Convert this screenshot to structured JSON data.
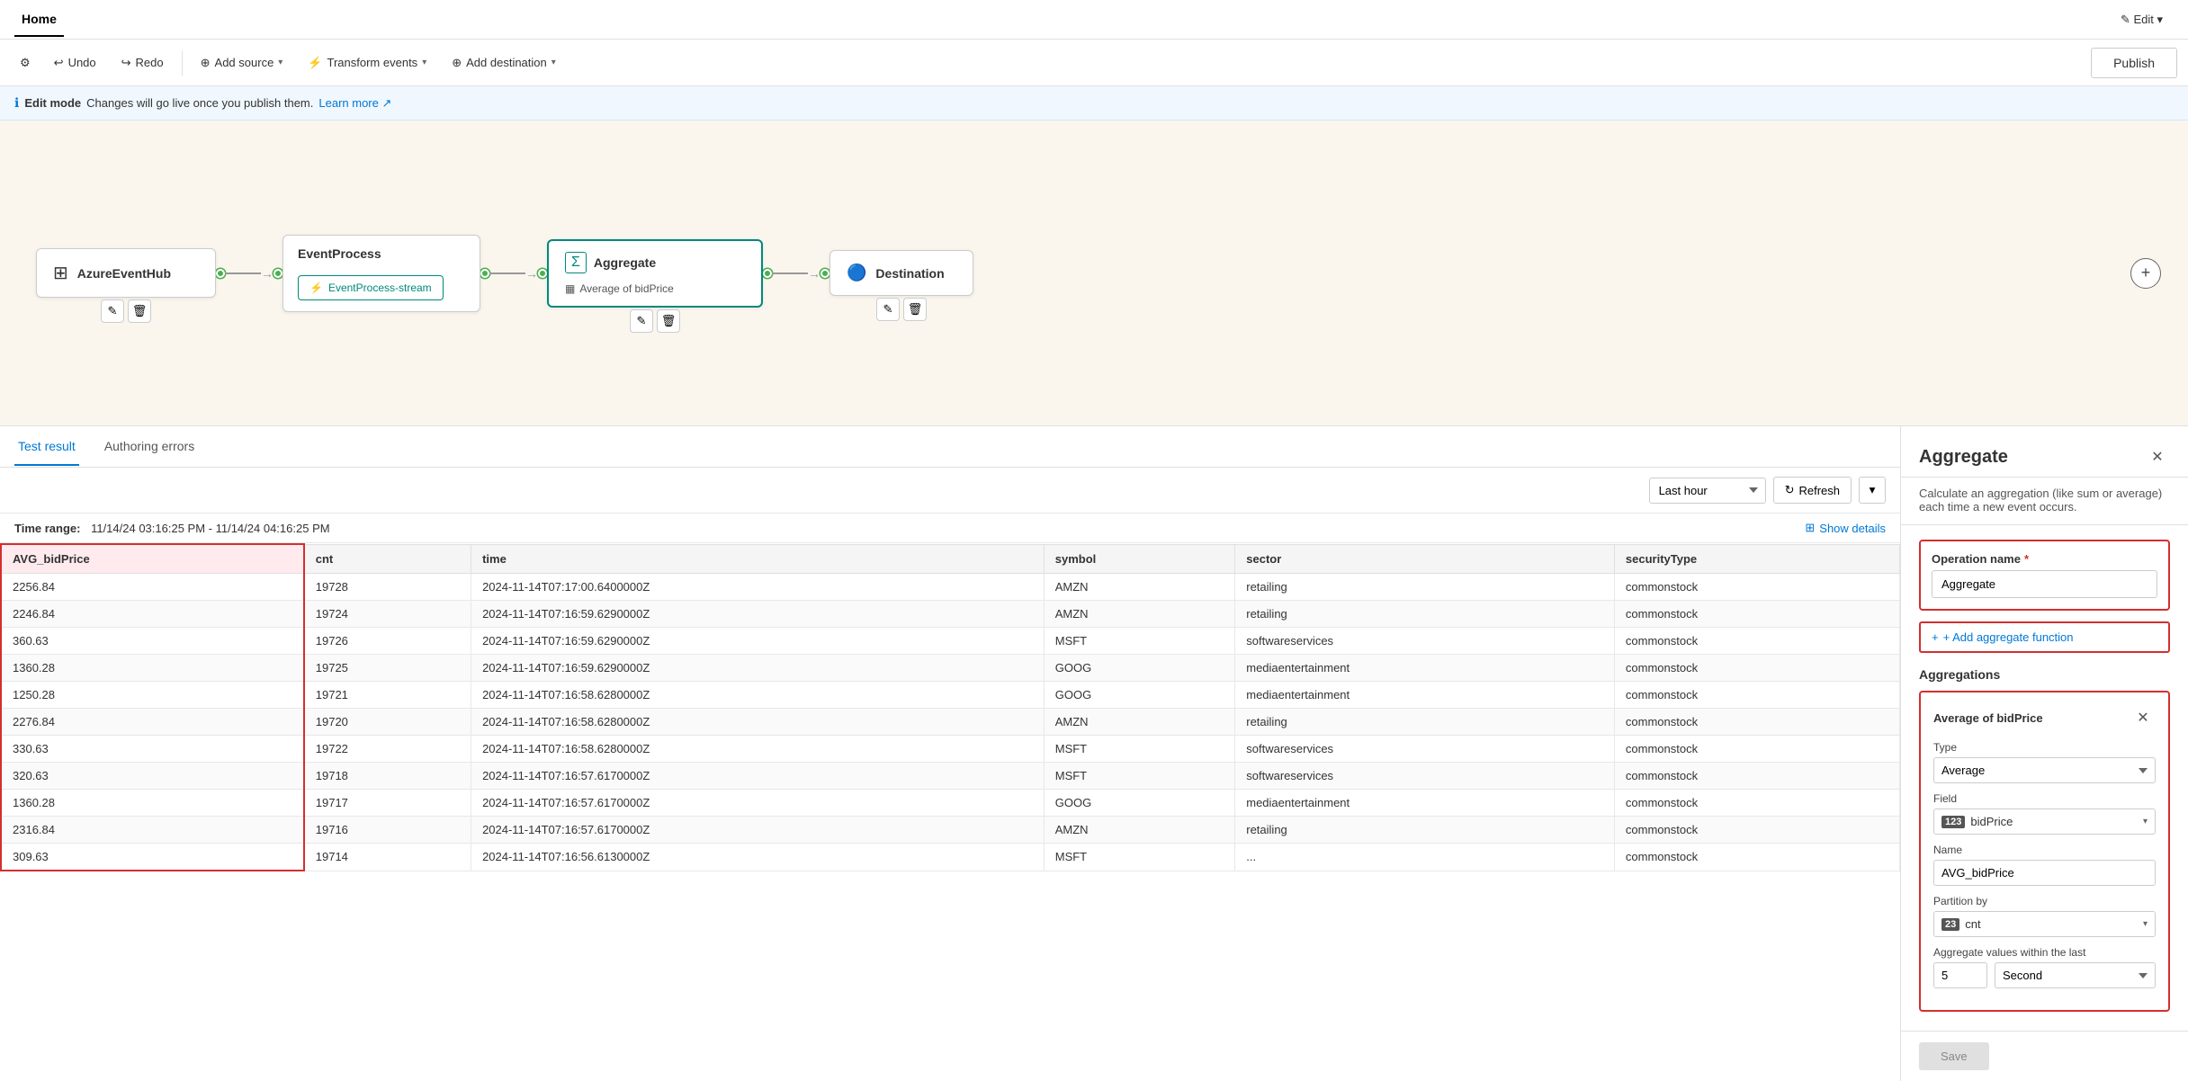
{
  "window": {
    "tab": "Home",
    "edit_label": "✎ Edit ▾"
  },
  "toolbar": {
    "settings_icon": "⚙",
    "undo_label": "Undo",
    "redo_label": "Redo",
    "add_source_label": "Add source",
    "transform_events_label": "Transform events",
    "add_destination_label": "Add destination",
    "publish_label": "Publish"
  },
  "banner": {
    "info_icon": "ℹ",
    "edit_mode_label": "Edit mode",
    "message": "Changes will go live once you publish them.",
    "learn_more": "Learn more ↗"
  },
  "pipeline": {
    "nodes": [
      {
        "id": "source",
        "title": "AzureEventHub",
        "icon": "⊞",
        "type": "source"
      },
      {
        "id": "process",
        "title": "EventProcess",
        "sub": "EventProcess-stream",
        "icon": "⚡",
        "type": "process"
      },
      {
        "id": "aggregate",
        "title": "Aggregate",
        "subtitle": "Average of bidPrice",
        "icon": "Σ",
        "type": "aggregate"
      },
      {
        "id": "destination",
        "title": "Destination",
        "icon": "🔵",
        "type": "destination"
      }
    ],
    "plus_label": "+"
  },
  "test_panel": {
    "tab_test": "Test result",
    "tab_errors": "Authoring errors",
    "time_range_label": "Time range:",
    "time_range_value": "11/14/24 03:16:25 PM - 11/14/24 04:16:25 PM",
    "last_hour": "Last hour",
    "refresh_label": "Refresh",
    "show_details_label": "Show details",
    "columns": [
      "AVG_bidPrice",
      "cnt",
      "time",
      "symbol",
      "sector",
      "securityType"
    ],
    "rows": [
      [
        "2256.84",
        "19728",
        "2024-11-14T07:17:00.6400000Z",
        "AMZN",
        "retailing",
        "commonstock"
      ],
      [
        "2246.84",
        "19724",
        "2024-11-14T07:16:59.6290000Z",
        "AMZN",
        "retailing",
        "commonstock"
      ],
      [
        "360.63",
        "19726",
        "2024-11-14T07:16:59.6290000Z",
        "MSFT",
        "softwareservices",
        "commonstock"
      ],
      [
        "1360.28",
        "19725",
        "2024-11-14T07:16:59.6290000Z",
        "GOOG",
        "mediaentertainment",
        "commonstock"
      ],
      [
        "1250.28",
        "19721",
        "2024-11-14T07:16:58.6280000Z",
        "GOOG",
        "mediaentertainment",
        "commonstock"
      ],
      [
        "2276.84",
        "19720",
        "2024-11-14T07:16:58.6280000Z",
        "AMZN",
        "retailing",
        "commonstock"
      ],
      [
        "330.63",
        "19722",
        "2024-11-14T07:16:58.6280000Z",
        "MSFT",
        "softwareservices",
        "commonstock"
      ],
      [
        "320.63",
        "19718",
        "2024-11-14T07:16:57.6170000Z",
        "MSFT",
        "softwareservices",
        "commonstock"
      ],
      [
        "1360.28",
        "19717",
        "2024-11-14T07:16:57.6170000Z",
        "GOOG",
        "mediaentertainment",
        "commonstock"
      ],
      [
        "2316.84",
        "19716",
        "2024-11-14T07:16:57.6170000Z",
        "AMZN",
        "retailing",
        "commonstock"
      ],
      [
        "309.63",
        "19714",
        "2024-11-14T07:16:56.6130000Z",
        "MSFT",
        "...",
        "commonstock"
      ]
    ]
  },
  "right_panel": {
    "title": "Aggregate",
    "description": "Calculate an aggregation (like sum or average) each time a new event occurs.",
    "close_icon": "✕",
    "operation_name_label": "Operation name",
    "operation_name_required": "*",
    "operation_name_value": "Aggregate",
    "add_aggregate_label": "+ Add aggregate function",
    "aggregations_label": "Aggregations",
    "agg_card": {
      "title": "Average of bidPrice",
      "close_icon": "✕",
      "type_label": "Type",
      "type_value": "Average",
      "field_label": "Field",
      "field_value": "bidPrice",
      "field_type_icon": "123",
      "name_label": "Name",
      "name_value": "AVG_bidPrice",
      "partition_label": "Partition by",
      "partition_value": "cnt",
      "partition_type_icon": "23",
      "aggregate_within_label": "Aggregate values within the last",
      "aggregate_number": "5",
      "aggregate_unit": "Second"
    },
    "save_label": "Save"
  },
  "destination": {
    "title": "Destination",
    "label": "Destination"
  }
}
